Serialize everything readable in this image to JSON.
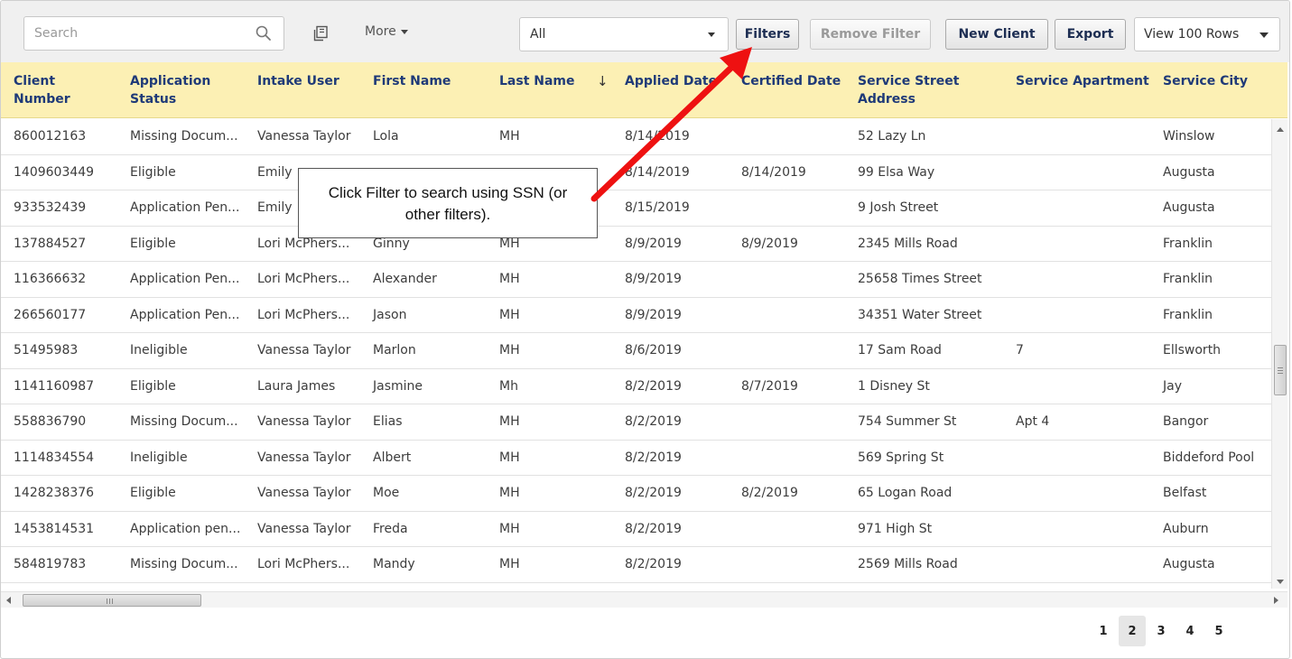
{
  "toolbar": {
    "search_placeholder": "Search",
    "more_label": "More",
    "filter_select_value": "All",
    "filters_label": "Filters",
    "remove_filter_label": "Remove Filter",
    "new_client_label": "New Client",
    "export_label": "Export",
    "rows_select_value": "View 100 Rows"
  },
  "table": {
    "columns": [
      "Client\nNumber",
      "Application\nStatus",
      "Intake User",
      "First Name",
      "Last Name",
      "Applied Date",
      "Certified Date",
      "Service Street\nAddress",
      "Service Apartment",
      "Service City"
    ],
    "sort_indicator": "↓",
    "rows": [
      [
        "860012163",
        "Missing Docum...",
        "Vanessa Taylor",
        "Lola",
        "MH",
        "8/14/2019",
        "",
        "52 Lazy Ln",
        "",
        "Winslow"
      ],
      [
        "1409603449",
        "Eligible",
        "Emily",
        "",
        "",
        "8/14/2019",
        "8/14/2019",
        "99 Elsa Way",
        "",
        "Augusta"
      ],
      [
        "933532439",
        "Application Pen...",
        "Emily",
        "",
        "",
        "8/15/2019",
        "",
        "9 Josh Street",
        "",
        "Augusta"
      ],
      [
        "137884527",
        "Eligible",
        "Lori McPhers...",
        "Ginny",
        "MH",
        "8/9/2019",
        "8/9/2019",
        "2345 Mills Road",
        "",
        "Franklin"
      ],
      [
        "116366632",
        "Application Pen...",
        "Lori McPhers...",
        "Alexander",
        "MH",
        "8/9/2019",
        "",
        "25658 Times Street",
        "",
        "Franklin"
      ],
      [
        "266560177",
        "Application Pen...",
        "Lori McPhers...",
        "Jason",
        "MH",
        "8/9/2019",
        "",
        "34351 Water Street",
        "",
        "Franklin"
      ],
      [
        "51495983",
        "Ineligible",
        "Vanessa Taylor",
        "Marlon",
        "MH",
        "8/6/2019",
        "",
        "17 Sam Road",
        "7",
        "Ellsworth"
      ],
      [
        "1141160987",
        "Eligible",
        "Laura James",
        "Jasmine",
        "Mh",
        "8/2/2019",
        "8/7/2019",
        "1 Disney St",
        "",
        "Jay"
      ],
      [
        "558836790",
        "Missing Docum...",
        "Vanessa Taylor",
        "Elias",
        "MH",
        "8/2/2019",
        "",
        "754 Summer St",
        "Apt 4",
        "Bangor"
      ],
      [
        "1114834554",
        "Ineligible",
        "Vanessa Taylor",
        "Albert",
        "MH",
        "8/2/2019",
        "",
        "569 Spring St",
        "",
        "Biddeford Pool"
      ],
      [
        "1428238376",
        "Eligible",
        "Vanessa Taylor",
        "Moe",
        "MH",
        "8/2/2019",
        "8/2/2019",
        "65 Logan Road",
        "",
        "Belfast"
      ],
      [
        "1453814531",
        "Application pen...",
        "Vanessa Taylor",
        "Freda",
        "MH",
        "8/2/2019",
        "",
        "971 High St",
        "",
        "Auburn"
      ],
      [
        "584819783",
        "Missing Docum...",
        "Lori McPhers...",
        "Mandy",
        "MH",
        "8/2/2019",
        "",
        "2569 Mills Road",
        "",
        "Augusta"
      ]
    ]
  },
  "pagination": {
    "pages": [
      "1",
      "2",
      "3",
      "4",
      "5"
    ],
    "active": "2"
  },
  "callout": {
    "text": "Click Filter to search using SSN (or other filters)."
  },
  "colors": {
    "header_bg": "#fcf0b4",
    "header_text": "#1f3a78",
    "annotation_arrow": "#ee1111"
  },
  "icons": {
    "search": "search-icon",
    "columns": "columns-icon",
    "dropdown": "chevron-down-icon"
  }
}
